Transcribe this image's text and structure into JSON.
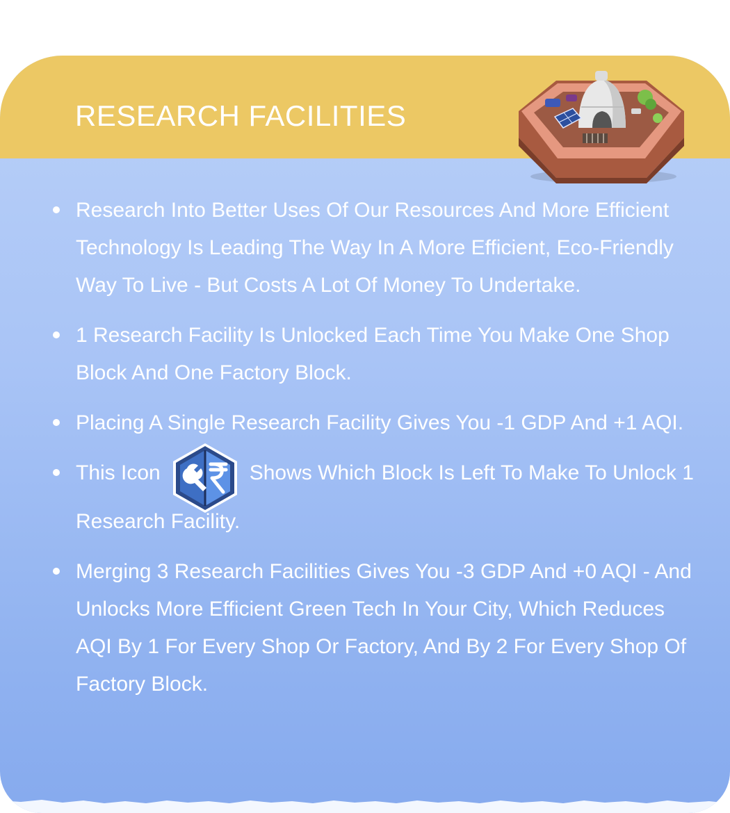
{
  "card": {
    "title": "RESEARCH FACILITIES",
    "header_color": "#ecc864",
    "body_gradient": [
      "#b9d0f8",
      "#86aaee"
    ],
    "header_image": "research-facility-dome-building"
  },
  "bullets": [
    {
      "text": "Research Into Better Uses Of Our Resources And More Efficient Technology Is Leading The Way In A More Efficient, Eco-Friendly Way To Live - But Costs A Lot Of Money To Undertake."
    },
    {
      "text": "1 Research Facility Is Unlocked Each Time You Make One Shop Block And One Factory Block."
    },
    {
      "text": "Placing A Single Research Facility Gives You -1 GDP And +1 AQI."
    },
    {
      "text_before": "This Icon",
      "icon": "wrench-rupee-hexagon-icon",
      "text_after": "Shows Which Block Is Left To Make To Unlock 1 Research Facility."
    },
    {
      "text": "Merging 3 Research Facilities Gives You -3 GDP And +0 AQI - And Unlocks More Efficient Green Tech In Your City, Which Reduces AQI By 1 For Every Shop Or Factory, And By 2 For Every Shop Of Factory Block."
    }
  ]
}
